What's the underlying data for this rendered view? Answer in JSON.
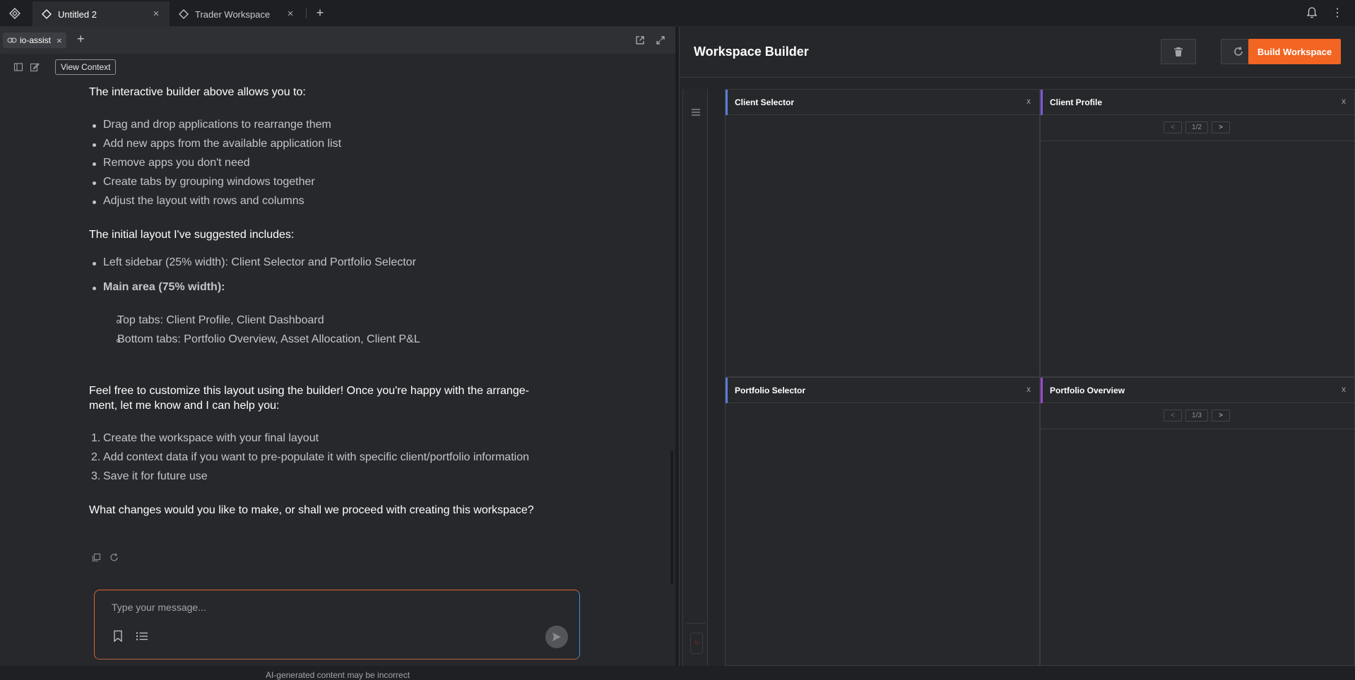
{
  "browser": {
    "tabs": [
      {
        "label": "Untitled 2",
        "active": true
      },
      {
        "label": "Trader Workspace",
        "active": false
      }
    ]
  },
  "chat": {
    "chip_label": "io-assist",
    "view_context_label": "View Context",
    "intro": "The interactive builder above allows you to:",
    "capabilities": [
      "Drag and drop applications to rearrange them",
      "Add new apps from the available application list",
      "Remove apps you don't need",
      "Create tabs by grouping windows together",
      "Adjust the layout with rows and columns"
    ],
    "layout_intro": "The initial layout I've suggested includes:",
    "layout_left": "Left sidebar (25% width): Client Selector and Portfolio Selector",
    "layout_main": "Main area (75% width):",
    "layout_sub": [
      "Top tabs: Client Profile, Client Dashboard",
      "Bottom tabs: Portfolio Overview, Asset Allocation, Client P&L"
    ],
    "customize_line1": "Feel free to customize this layout using the builder! Once you're happy with the arrange-",
    "customize_line2": "ment, let me know and I can help you:",
    "steps": [
      "Create the workspace with your final layout",
      "Add context data if you want to pre-populate it with specific client/portfolio information",
      "Save it for future use"
    ],
    "question": "What changes would you like to make, or shall we proceed with creating this workspace?",
    "input_placeholder": "Type your message...",
    "disclaimer": "AI-generated content may be incorrect"
  },
  "builder": {
    "title": "Workspace Builder",
    "build_label": "Build Workspace",
    "windows": [
      {
        "title": "Client Selector",
        "accent": "#5b7bd5",
        "close": "x"
      },
      {
        "title": "Client Profile",
        "accent": "#7d5bd5",
        "close": "x",
        "pager": "1/2"
      },
      {
        "title": "Portfolio Selector",
        "accent": "#5b7bd5",
        "close": "x"
      },
      {
        "title": "Portfolio Overview",
        "accent": "#9b4bd0",
        "close": "x",
        "pager": "1/3"
      }
    ],
    "pager_prev": "<",
    "pager_next": ">"
  },
  "colors": {
    "accent_orange": "#f26522",
    "background": "#27282c"
  }
}
